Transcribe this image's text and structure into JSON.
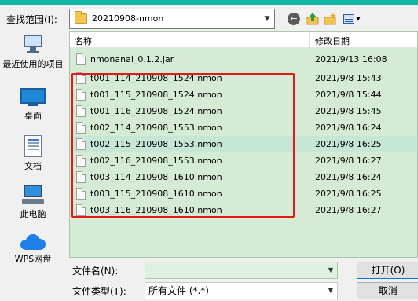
{
  "toolbar": {
    "lookin_label": "查找范围(I):",
    "lookin_value": "20210908-nmon",
    "icons": [
      "back-icon",
      "up-folder-icon",
      "new-folder-icon",
      "views-menu-icon"
    ]
  },
  "places": [
    {
      "label": "最近使用的项目",
      "icon": "recent-items-icon"
    },
    {
      "label": "桌面",
      "icon": "desktop-icon"
    },
    {
      "label": "文档",
      "icon": "documents-icon"
    },
    {
      "label": "此电脑",
      "icon": "computer-icon"
    },
    {
      "label": "WPS网盘",
      "icon": "cloud-drive-icon"
    }
  ],
  "list": {
    "columns": [
      "名称",
      "修改日期"
    ],
    "rows": [
      {
        "name": "nmonanal_0.1.2.jar",
        "date": "2021/9/13 16:08"
      },
      {
        "name": "t001_114_210908_1524.nmon",
        "date": "2021/9/8 15:43"
      },
      {
        "name": "t001_115_210908_1524.nmon",
        "date": "2021/9/8 15:44"
      },
      {
        "name": "t001_116_210908_1524.nmon",
        "date": "2021/9/8 15:45"
      },
      {
        "name": "t002_114_210908_1553.nmon",
        "date": "2021/9/8 16:24"
      },
      {
        "name": "t002_115_210908_1553.nmon",
        "date": "2021/9/8 16:25"
      },
      {
        "name": "t002_116_210908_1553.nmon",
        "date": "2021/9/8 16:27"
      },
      {
        "name": "t003_114_210908_1610.nmon",
        "date": "2021/9/8 16:24"
      },
      {
        "name": "t003_115_210908_1610.nmon",
        "date": "2021/9/8 16:25"
      },
      {
        "name": "t003_116_210908_1610.nmon",
        "date": "2021/9/8 16:27"
      }
    ]
  },
  "filename": {
    "label": "文件名(N):",
    "value": ""
  },
  "filetype": {
    "label": "文件类型(T):",
    "value": "所有文件 (*.*)"
  },
  "buttons": {
    "open": "打开(O)",
    "cancel": "取消"
  },
  "colors": {
    "list_bg": "#d6ebd6",
    "selected_row": "#c6e6d6",
    "highlight_box": "#e21919",
    "title_strip": "#11b8a8"
  }
}
